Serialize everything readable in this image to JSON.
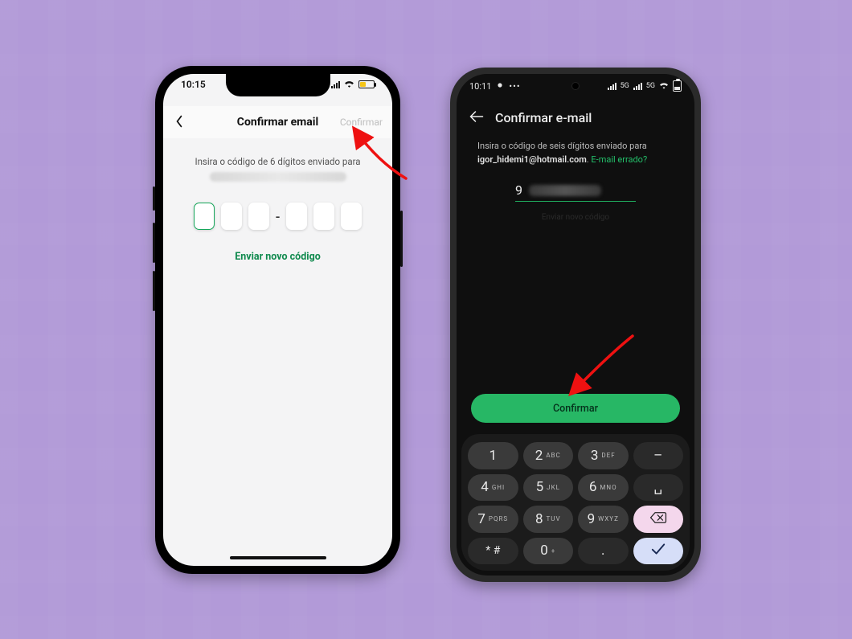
{
  "left": {
    "status": {
      "time": "10:15"
    },
    "nav": {
      "title": "Confirmar email",
      "confirm_label": "Confirmar"
    },
    "instruction": "Insira o código de 6 dígitos enviado para",
    "resend_label": "Enviar novo código",
    "code_dash": "-"
  },
  "right": {
    "status": {
      "time": "10:11",
      "net_label": "5G",
      "net_label2": "5G"
    },
    "nav": {
      "title": "Confirmar e-mail"
    },
    "instruction_prefix": "Insira o código de seis dígitos enviado para",
    "email": "igor_hidemi1@hotmail.com",
    "instruction_sep": ". ",
    "wrong_email_label": "E-mail errado?",
    "code_first_digit": "9",
    "hint": "Enviar novo código",
    "confirm_label": "Confirmar",
    "keypad": {
      "k1": {
        "n": "1",
        "s": ""
      },
      "k2": {
        "n": "2",
        "s": "ABC"
      },
      "k3": {
        "n": "3",
        "s": "DEF"
      },
      "kdash": {
        "n": "–",
        "s": ""
      },
      "k4": {
        "n": "4",
        "s": "GHI"
      },
      "k5": {
        "n": "5",
        "s": "JKL"
      },
      "k6": {
        "n": "6",
        "s": "MNO"
      },
      "kspace": {
        "n": "␣",
        "s": ""
      },
      "k7": {
        "n": "7",
        "s": "PQRS"
      },
      "k8": {
        "n": "8",
        "s": "TUV"
      },
      "k9": {
        "n": "9",
        "s": "WXYZ"
      },
      "kbksp": {
        "n": "⌫",
        "s": ""
      },
      "ksym": {
        "n": "* #",
        "s": ""
      },
      "k0": {
        "n": "0",
        "s": "+"
      },
      "kdot": {
        "n": ".",
        "s": ""
      },
      "kenter": {
        "n": "✓",
        "s": ""
      }
    }
  }
}
